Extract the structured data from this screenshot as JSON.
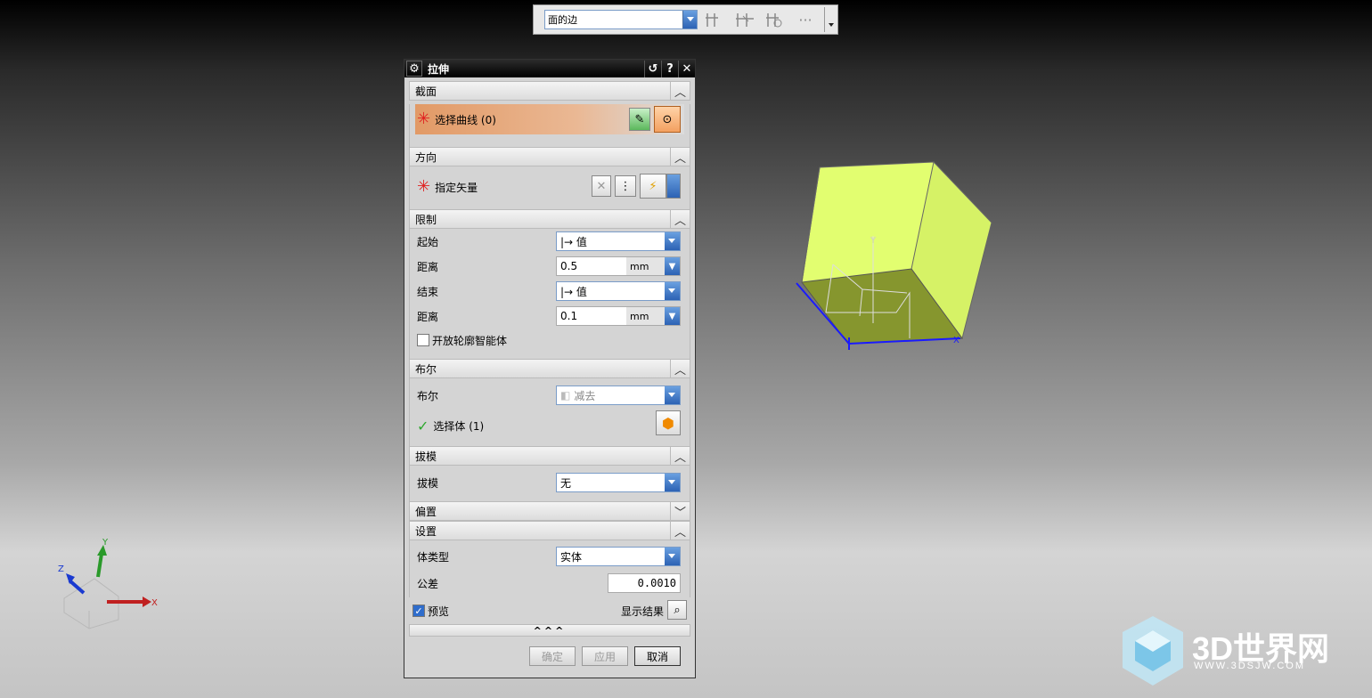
{
  "toolbar": {
    "filter_value": "面的边",
    "more_glyph": "···"
  },
  "dialog": {
    "title": "拉伸",
    "sections": {
      "section": {
        "title": "截面",
        "select_curve": "选择曲线 (0)"
      },
      "direction": {
        "title": "方向",
        "specify_vector": "指定矢量"
      },
      "limits": {
        "title": "限制",
        "start_label": "起始",
        "start_value": "|→ 值",
        "start_distance_label": "距离",
        "start_distance": "0.5",
        "start_unit": "mm",
        "end_label": "结束",
        "end_value": "|→ 值",
        "end_distance_label": "距离",
        "end_distance": "0.1",
        "end_unit": "mm",
        "open_profile": "开放轮廓智能体"
      },
      "boolean": {
        "title": "布尔",
        "boolean_label": "布尔",
        "boolean_value": "减去",
        "select_body": "选择体 (1)"
      },
      "draft": {
        "title": "拔模",
        "draft_label": "拔模",
        "draft_value": "无"
      },
      "offset": {
        "title": "偏置"
      },
      "settings": {
        "title": "设置",
        "body_type_label": "体类型",
        "body_type_value": "实体",
        "tolerance_label": "公差",
        "tolerance_value": "0.0010"
      }
    },
    "preview_label": "预览",
    "show_result_label": "显示结果",
    "more_label": "^^^",
    "ok_label": "确定",
    "apply_label": "应用",
    "cancel_label": "取消"
  },
  "viewport": {
    "cube_color": "#e2fe70",
    "triad": {
      "x": "X",
      "y": "Y",
      "z": "Z"
    },
    "wcs": {
      "x": "X",
      "y": "Y"
    }
  },
  "watermark": {
    "brand": "3D世界网",
    "url": "WWW.3DSJW.COM"
  }
}
